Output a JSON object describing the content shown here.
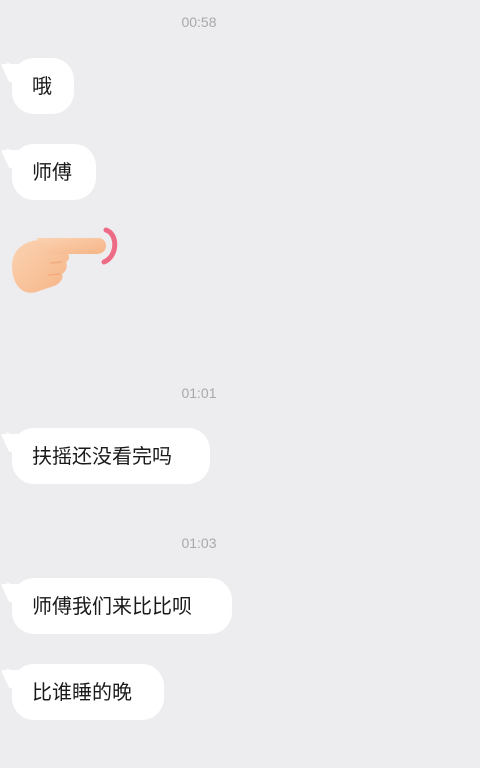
{
  "timestamps": [
    "00:58",
    "01:01",
    "01:03"
  ],
  "messages": [
    "哦",
    "师傅",
    "扶摇还没看完吗",
    "师傅我们来比比呗",
    "比谁睡的晚"
  ],
  "sticker": {
    "icon": "pointing-hand-icon",
    "skin_color": "#f9c49c",
    "accent_color": "#ee6b86"
  }
}
